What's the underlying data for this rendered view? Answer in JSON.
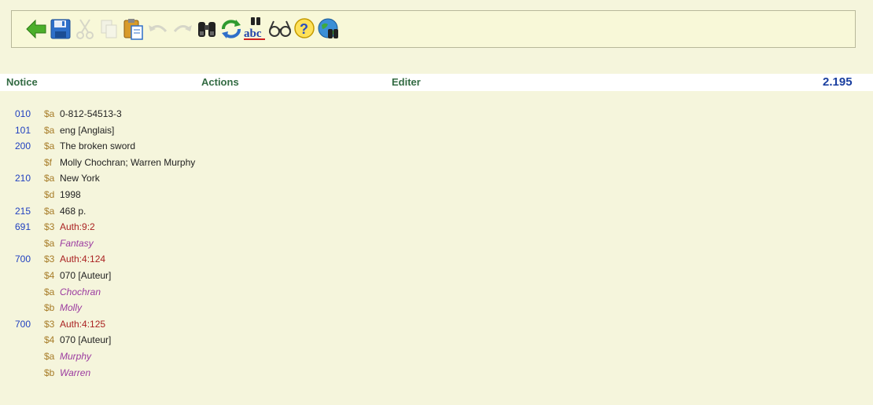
{
  "toolbar": {
    "buttons": [
      {
        "icon": "back-arrow-icon",
        "enabled": true
      },
      {
        "icon": "save-disk-icon",
        "enabled": true
      },
      {
        "icon": "cut-scissors-icon",
        "enabled": false
      },
      {
        "icon": "copy-icon",
        "enabled": false
      },
      {
        "icon": "paste-icon",
        "enabled": true
      },
      {
        "icon": "undo-icon",
        "enabled": false
      },
      {
        "icon": "redo-icon",
        "enabled": false
      },
      {
        "icon": "binoculars-icon",
        "enabled": true
      },
      {
        "icon": "refresh-icon",
        "enabled": true
      },
      {
        "icon": "spellcheck-icon",
        "enabled": true
      },
      {
        "icon": "glasses-icon",
        "enabled": true
      },
      {
        "icon": "help-icon",
        "enabled": true
      },
      {
        "icon": "globe-search-icon",
        "enabled": true
      }
    ]
  },
  "header": {
    "notice": "Notice",
    "actions": "Actions",
    "editer": "Editer",
    "count": "2.195"
  },
  "colors": {
    "background": "#f5f5dc",
    "tag": "#2040c0",
    "subfield": "#a77c28",
    "link": "#aa2222",
    "authority": "#9b3aa0"
  },
  "record": [
    {
      "tag": "010",
      "code": "$a",
      "value": "0-812-54513-3",
      "style": "normal"
    },
    {
      "tag": "101",
      "code": "$a",
      "value": "eng [Anglais]",
      "style": "normal"
    },
    {
      "tag": "200",
      "code": "$a",
      "value": "The broken sword",
      "style": "normal"
    },
    {
      "tag": "",
      "code": "$f",
      "value": "Molly Chochran; Warren Murphy",
      "style": "normal"
    },
    {
      "tag": "210",
      "code": "$a",
      "value": "New York",
      "style": "normal"
    },
    {
      "tag": "",
      "code": "$d",
      "value": "1998",
      "style": "normal"
    },
    {
      "tag": "215",
      "code": "$a",
      "value": "468 p.",
      "style": "normal"
    },
    {
      "tag": "691",
      "code": "$3",
      "value": "Auth:9:2",
      "style": "link"
    },
    {
      "tag": "",
      "code": "$a",
      "value": "Fantasy",
      "style": "auth"
    },
    {
      "tag": "700",
      "code": "$3",
      "value": "Auth:4:124",
      "style": "link"
    },
    {
      "tag": "",
      "code": "$4",
      "value": "070 [Auteur]",
      "style": "normal"
    },
    {
      "tag": "",
      "code": "$a",
      "value": "Chochran",
      "style": "auth"
    },
    {
      "tag": "",
      "code": "$b",
      "value": "Molly",
      "style": "auth"
    },
    {
      "tag": "700",
      "code": "$3",
      "value": "Auth:4:125",
      "style": "link"
    },
    {
      "tag": "",
      "code": "$4",
      "value": "070 [Auteur]",
      "style": "normal"
    },
    {
      "tag": "",
      "code": "$a",
      "value": "Murphy",
      "style": "auth"
    },
    {
      "tag": "",
      "code": "$b",
      "value": "Warren",
      "style": "auth"
    }
  ]
}
